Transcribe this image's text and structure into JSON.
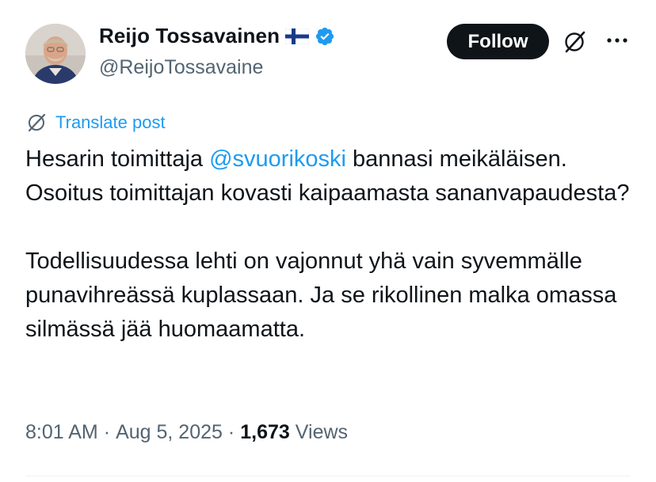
{
  "author": {
    "display_name": "Reijo Tossavainen",
    "handle": "@ReijoTossavaine",
    "avatar_icon": "avatar-photo",
    "flag_icon": "finland-flag-icon",
    "verified_icon": "verified-badge-icon"
  },
  "actions": {
    "follow_label": "Follow",
    "grok_icon": "grok-icon",
    "more_icon": "more-icon"
  },
  "translate": {
    "label": "Translate post",
    "icon": "translate-icon"
  },
  "tweet": {
    "text_before_mention": "Hesarin toimittaja ",
    "mention": "@svuorikoski",
    "text_after_mention": " bannasi meikäläisen. Osoitus toimittajan kovasti kaipaamasta sananvapaudesta?",
    "paragraph_2": "Todellisuudessa lehti on vajonnut yhä vain syvemmälle punavihreässä kuplassaan. Ja se rikollinen malka omassa silmässä jää huomaamatta."
  },
  "meta": {
    "time": "8:01 AM",
    "separator": "·",
    "date": "Aug 5, 2025",
    "views_count": "1,673",
    "views_label": "Views"
  },
  "colors": {
    "accent": "#1d9bf0",
    "text": "#0f1419",
    "secondary": "#536471",
    "verified": "#1d9bf0",
    "button_bg": "#0f1419"
  }
}
